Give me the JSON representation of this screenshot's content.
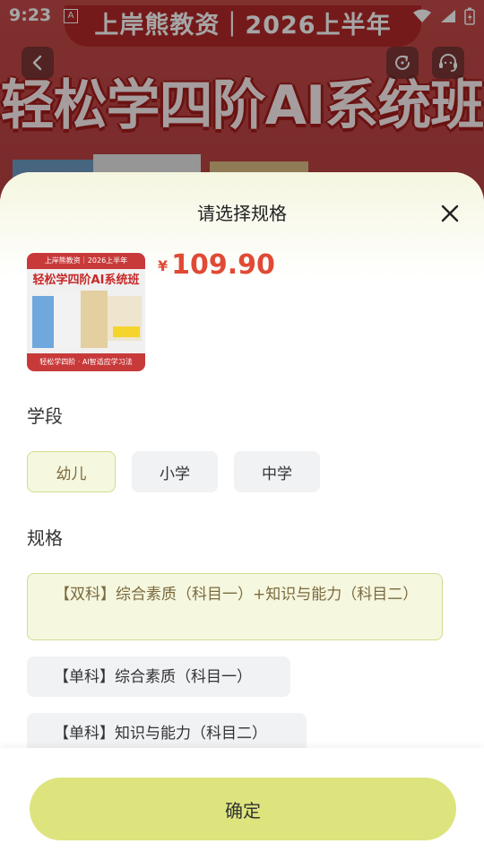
{
  "status_bar": {
    "time": "9:23",
    "notification_letter": "A"
  },
  "background": {
    "banner": "上岸熊教资｜2026上半年",
    "title": "轻松学四阶AI系统班"
  },
  "sheet": {
    "title": "请选择规格",
    "product": {
      "thumb_banner": "上岸熊教资｜2026上半年",
      "thumb_title": "轻松学四阶AI系统班",
      "thumb_bottom": "轻松学四阶 · AI智适应学习法",
      "currency": "¥",
      "price": "109.90"
    },
    "stage": {
      "label": "学段",
      "options": [
        {
          "label": "幼儿",
          "selected": true
        },
        {
          "label": "小学",
          "selected": false
        },
        {
          "label": "中学",
          "selected": false
        }
      ]
    },
    "spec": {
      "label": "规格",
      "options": [
        {
          "label": "【双科】综合素质（科目一）+知识与能力（科目二）",
          "selected": true
        },
        {
          "label": "【单科】综合素质（科目一）",
          "selected": false
        },
        {
          "label": "【单科】知识与能力（科目二）",
          "selected": false
        }
      ]
    },
    "confirm_label": "确定"
  },
  "colors": {
    "accent": "#dde47e",
    "price": "#e04a35",
    "selected_bg": "#f5f7df",
    "selected_border": "#d3dc92"
  }
}
